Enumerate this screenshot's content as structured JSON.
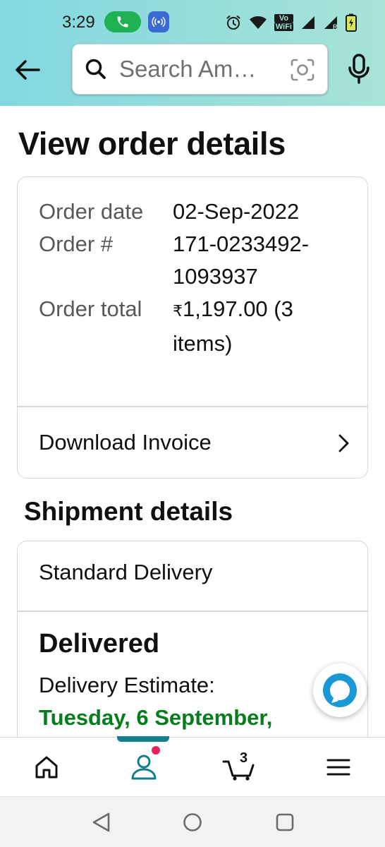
{
  "status_bar": {
    "time": "3:29",
    "volte_top": "Vo",
    "volte_bottom": "WiFi",
    "volte_sub": "1",
    "roaming": "R"
  },
  "search": {
    "placeholder": "Search Am…"
  },
  "page": {
    "title": "View order details"
  },
  "order": {
    "rows": [
      {
        "label": "Order date",
        "value": "02-Sep-2022"
      },
      {
        "label": "Order #",
        "value": "171-0233492-1093937"
      },
      {
        "label": "Order total",
        "currency": "₹",
        "value": "1,197.00 (3 items)"
      }
    ],
    "download_invoice_label": "Download Invoice"
  },
  "shipment": {
    "section_title": "Shipment details",
    "delivery_type": "Standard Delivery",
    "status": "Delivered",
    "estimate_label": "Delivery Estimate:",
    "estimate_date": "Tuesday, 6 September,"
  },
  "bottom_nav": {
    "items": [
      {
        "icon": "home-icon"
      },
      {
        "icon": "user-icon",
        "active": true,
        "has_notification": true
      },
      {
        "icon": "cart-icon",
        "count": "3"
      },
      {
        "icon": "menu-icon"
      }
    ]
  },
  "colors": {
    "header_gradient_start": "#82d8e0",
    "header_gradient_end": "#a8e3d6",
    "delivery_green": "#067d1d",
    "active_tab": "#137f8c",
    "notification_dot": "#e7225a",
    "alexa_blue": "#1a98d5"
  }
}
